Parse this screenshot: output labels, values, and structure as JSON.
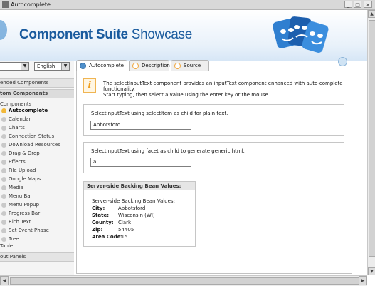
{
  "window": {
    "title": "Autocomplete",
    "controls": [
      "_",
      "□",
      "×"
    ]
  },
  "header": {
    "brand_bold": "Component Suite",
    "brand_light": " Showcase",
    "logo_icon": "theater-masks-logo"
  },
  "sidebar": {
    "filter_select": {
      "value": "",
      "arrow": "▼"
    },
    "language_select": {
      "value": "English",
      "arrow": "▼"
    },
    "sections": {
      "extended": "ended Components",
      "custom": "tom Components",
      "components_root": "Components",
      "table": "Table",
      "layout": "out Panels"
    },
    "items": [
      {
        "label": "Autocomplete",
        "active": true
      },
      {
        "label": "Calendar"
      },
      {
        "label": "Charts"
      },
      {
        "label": "Connection Status"
      },
      {
        "label": "Download Resources"
      },
      {
        "label": "Drag & Drop"
      },
      {
        "label": "Effects"
      },
      {
        "label": "File Upload"
      },
      {
        "label": "Google Maps"
      },
      {
        "label": "Media"
      },
      {
        "label": "Menu Bar"
      },
      {
        "label": "Menu Popup"
      },
      {
        "label": "Progress Bar"
      },
      {
        "label": "Rich Text"
      },
      {
        "label": "Set Event Phase"
      },
      {
        "label": "Tree"
      }
    ]
  },
  "tabs": [
    {
      "label": "Autocomplete",
      "active": true,
      "icon": "globe-icon"
    },
    {
      "label": "Description",
      "active": false,
      "icon": "info-icon"
    },
    {
      "label": "Source",
      "active": false,
      "icon": "info-icon"
    }
  ],
  "main": {
    "info_icon_glyph": "i",
    "description": "The selectInputText component provides an inputText component enhanced with auto-complete functionality.",
    "instructions": "Start typing, then select a value using the enter key or the mouse.",
    "example1": {
      "label": "SelectInputText using selectItem as child for plain text.",
      "value": "Abbotsford"
    },
    "example2": {
      "label": "SelectInputText using facet as child to generate generic html.",
      "value": "a"
    },
    "backing_bean": {
      "title": "Server-side Backing Bean Values:",
      "subtitle": "Server-side Backing Bean Values:",
      "rows": [
        {
          "key": "City:",
          "value": "Abbotsford"
        },
        {
          "key": "State:",
          "value": "Wisconsin (WI)"
        },
        {
          "key": "County:",
          "value": "Clark"
        },
        {
          "key": "Zip:",
          "value": "54405"
        },
        {
          "key": "Area Code:",
          "value": "715"
        }
      ]
    }
  },
  "colors": {
    "brand_blue": "#1a5b9e",
    "active_dot": "#f2b93a",
    "info_orange": "#f0a020"
  }
}
